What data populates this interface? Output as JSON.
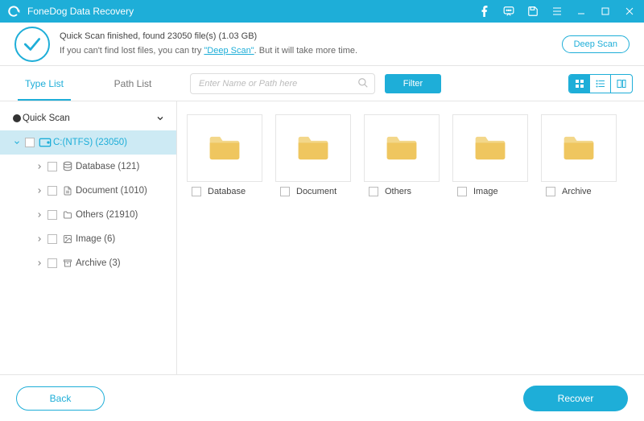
{
  "titlebar": {
    "title": "FoneDog Data Recovery"
  },
  "info": {
    "line1_prefix": "Quick Scan finished, found ",
    "file_count": "23050",
    "line1_mid": " file(s) (",
    "total_size": "1.03 GB",
    "line1_suffix": ")",
    "line2_prefix": "If you can't find lost files, you can try ",
    "deep_scan_link": "\"Deep Scan\"",
    "line2_suffix": ". But it will take more time.",
    "deep_scan_btn": "Deep Scan"
  },
  "tabs": {
    "type_list": "Type List",
    "path_list": "Path List"
  },
  "search": {
    "placeholder": "Enter Name or Path here"
  },
  "filter_label": "Filter",
  "sidebar": {
    "quick_scan": "Quick Scan",
    "drive": "C:(NTFS) (23050)",
    "items": [
      {
        "label": "Database (121)"
      },
      {
        "label": "Document (1010)"
      },
      {
        "label": "Others (21910)"
      },
      {
        "label": "Image (6)"
      },
      {
        "label": "Archive (3)"
      }
    ]
  },
  "grid": {
    "items": [
      {
        "label": "Database"
      },
      {
        "label": "Document"
      },
      {
        "label": "Others"
      },
      {
        "label": "Image"
      },
      {
        "label": "Archive"
      }
    ]
  },
  "footer": {
    "back": "Back",
    "recover": "Recover"
  },
  "colors": {
    "accent": "#1eaed8"
  }
}
